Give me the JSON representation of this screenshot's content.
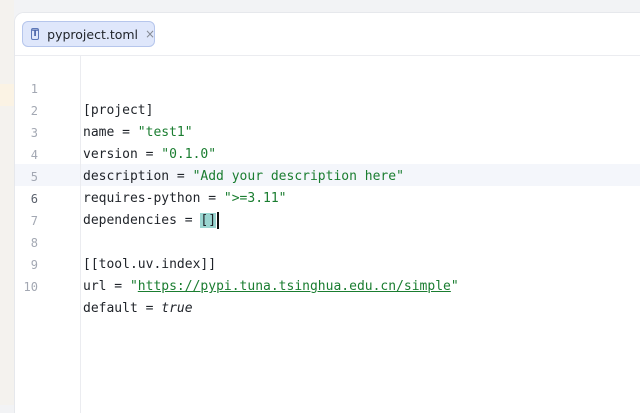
{
  "tab": {
    "icon": "toml-file-icon",
    "label": "pyproject.toml",
    "close": "×"
  },
  "lines": [
    {
      "n": "1",
      "section": "[project]"
    },
    {
      "n": "2",
      "key": "name",
      "eq": " = ",
      "value": "\"test1\""
    },
    {
      "n": "3",
      "key": "version",
      "eq": " = ",
      "value": "\"0.1.0\""
    },
    {
      "n": "4",
      "key": "description",
      "eq": " = ",
      "value": "\"Add your description here\""
    },
    {
      "n": "5",
      "key": "requires-python",
      "eq": " = ",
      "value": "\">=3.11\""
    },
    {
      "n": "6",
      "key": "dependencies",
      "eq": " = ",
      "open": "[",
      "close": "]"
    },
    {
      "n": "7"
    },
    {
      "n": "8",
      "section": "[[tool.uv.index]]"
    },
    {
      "n": "9",
      "key": "url",
      "eq": " = ",
      "q1": "\"",
      "url": "https://pypi.tuna.tsinghua.edu.cn/simple",
      "q2": "\""
    },
    {
      "n": "10",
      "key": "default",
      "eq": " = ",
      "value": "true"
    }
  ],
  "colors": {
    "string": "#1a7d30",
    "bracket_highlight": "#9ad5d0",
    "tab_bg": "#dfe7fb"
  }
}
